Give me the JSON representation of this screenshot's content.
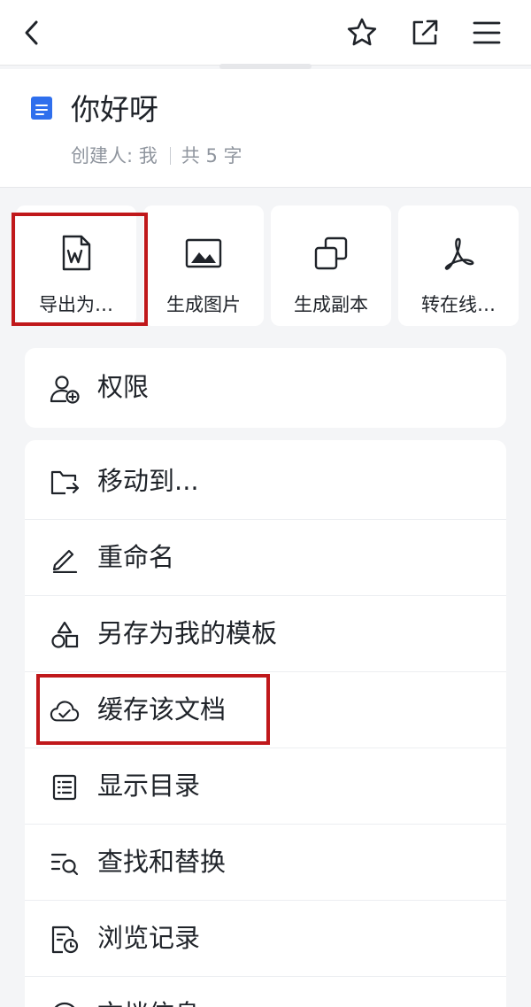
{
  "topbar": {
    "back_icon": "chevron-left-icon",
    "star_icon": "star-icon",
    "share_icon": "share-external-icon",
    "menu_icon": "menu-icon"
  },
  "document": {
    "icon": "doc-icon",
    "icon_color": "#2f6fed",
    "title": "你好呀",
    "creator_label": "创建人: 我",
    "word_count": "共 5 字"
  },
  "quick_actions": [
    {
      "label": "导出为…",
      "icon": "word-export-icon"
    },
    {
      "label": "生成图片",
      "icon": "image-icon"
    },
    {
      "label": "生成副本",
      "icon": "copy-icon"
    },
    {
      "label": "转在线…",
      "icon": "pdf-icon"
    }
  ],
  "menu": [
    {
      "label": "权限",
      "icon": "user-permission-icon"
    },
    {
      "label": "移动到...",
      "icon": "folder-move-icon"
    },
    {
      "label": "重命名",
      "icon": "pencil-icon"
    },
    {
      "label": "另存为我的模板",
      "icon": "shapes-template-icon"
    },
    {
      "label": "缓存该文档",
      "icon": "cloud-check-icon"
    },
    {
      "label": "显示目录",
      "icon": "list-icon"
    },
    {
      "label": "查找和替换",
      "icon": "search-replace-icon"
    },
    {
      "label": "浏览记录",
      "icon": "history-icon"
    },
    {
      "label": "文档信息",
      "icon": "info-icon"
    }
  ],
  "colors": {
    "highlight": "#c0181b",
    "background": "#f4f5f7",
    "text_primary": "#1f2329",
    "text_secondary": "#8f959e"
  }
}
